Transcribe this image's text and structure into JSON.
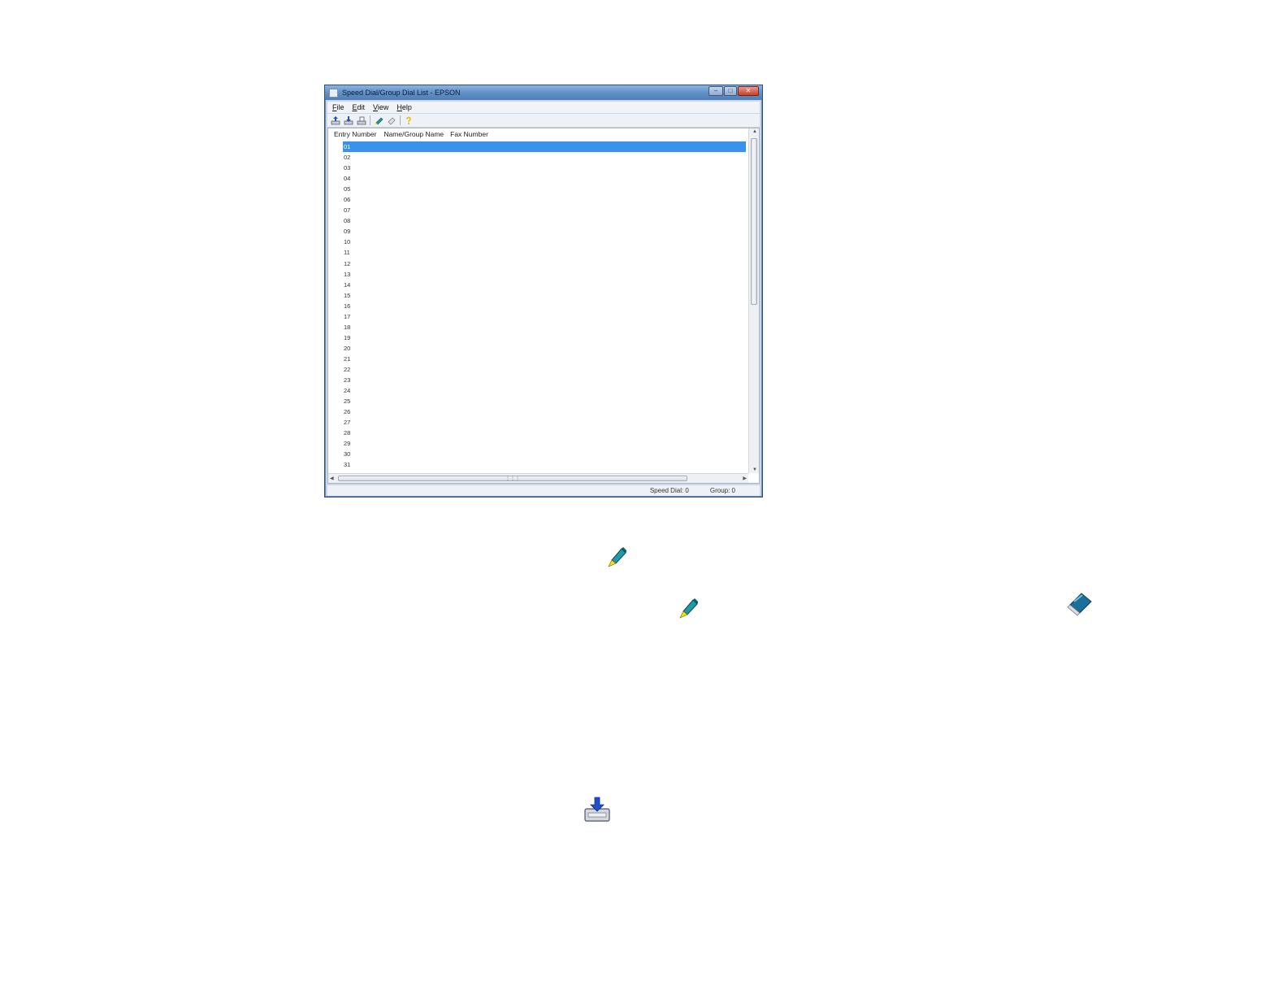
{
  "window": {
    "title": "Speed Dial/Group Dial List - EPSON",
    "controls": {
      "minimize": "–",
      "maximize": "□",
      "close": "✕"
    }
  },
  "menu": [
    {
      "label_u": "F",
      "label_rest": "ile"
    },
    {
      "label_u": "E",
      "label_rest": "dit"
    },
    {
      "label_u": "V",
      "label_rest": "iew"
    },
    {
      "label_u": "H",
      "label_rest": "elp"
    }
  ],
  "toolbar": {
    "icons": [
      "tray-upload-icon",
      "tray-download-icon",
      "tray-save-icon",
      "pencil-icon",
      "eraser-icon",
      "help-icon"
    ]
  },
  "list": {
    "columns": [
      "Entry Number",
      "Name/Group Name",
      "Fax Number"
    ],
    "selected_index": 0,
    "rows": [
      "01",
      "02",
      "03",
      "04",
      "05",
      "06",
      "07",
      "08",
      "09",
      "10",
      "11",
      "12",
      "13",
      "14",
      "15",
      "16",
      "17",
      "18",
      "19",
      "20",
      "21",
      "22",
      "23",
      "24",
      "25",
      "26",
      "27",
      "28",
      "29",
      "30",
      "31"
    ]
  },
  "status": {
    "speed_dial": "Speed Dial: 0",
    "group": "Group: 0"
  },
  "colors": {
    "selection": "#3b92ea",
    "pencil_body": "#1f9aa8",
    "pencil_tip": "#f3e21b",
    "eraser_body": "#1c6f9a",
    "tray_arrow": "#1f4fc9"
  },
  "doc_icons": [
    "pencil-icon",
    "pencil-icon",
    "eraser-icon",
    "tray-download-icon"
  ]
}
